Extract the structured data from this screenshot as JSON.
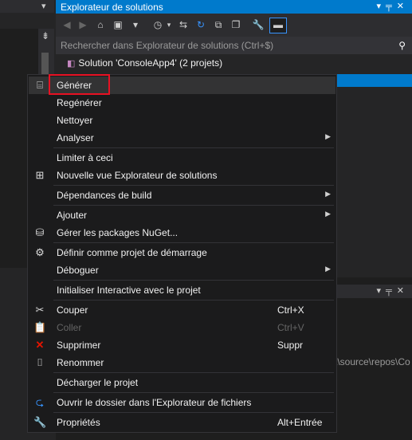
{
  "solution_explorer": {
    "title": "Explorateur de solutions",
    "search_placeholder": "Rechercher dans Explorateur de solutions (Ctrl+$)",
    "solution_node": "Solution 'ConsoleApp4' (2 projets)"
  },
  "lower_panel": {
    "path_fragment": "t\\source\\repos\\Co"
  },
  "menu": {
    "items": [
      {
        "label": "Générer",
        "shortcut": "",
        "submenu": false,
        "icon": "build-icon",
        "enabled": true
      },
      {
        "label": "Regénérer",
        "shortcut": "",
        "submenu": false,
        "icon": "",
        "enabled": true
      },
      {
        "label": "Nettoyer",
        "shortcut": "",
        "submenu": false,
        "icon": "",
        "enabled": true
      },
      {
        "label": "Analyser",
        "shortcut": "",
        "submenu": true,
        "icon": "",
        "enabled": true
      },
      {
        "label": "Limiter à ceci",
        "shortcut": "",
        "submenu": false,
        "icon": "",
        "enabled": true
      },
      {
        "label": "Nouvelle vue Explorateur de solutions",
        "shortcut": "",
        "submenu": false,
        "icon": "new-view-icon",
        "enabled": true
      },
      {
        "label": "Dépendances de build",
        "shortcut": "",
        "submenu": true,
        "icon": "",
        "enabled": true
      },
      {
        "label": "Ajouter",
        "shortcut": "",
        "submenu": true,
        "icon": "",
        "enabled": true
      },
      {
        "label": "Gérer les packages NuGet...",
        "shortcut": "",
        "submenu": false,
        "icon": "nuget-icon",
        "enabled": true
      },
      {
        "label": "Définir comme projet de démarrage",
        "shortcut": "",
        "submenu": false,
        "icon": "gear-icon",
        "enabled": true
      },
      {
        "label": "Déboguer",
        "shortcut": "",
        "submenu": true,
        "icon": "",
        "enabled": true
      },
      {
        "label": "Initialiser Interactive avec le projet",
        "shortcut": "",
        "submenu": false,
        "icon": "",
        "enabled": true
      },
      {
        "label": "Couper",
        "shortcut": "Ctrl+X",
        "submenu": false,
        "icon": "cut-icon",
        "enabled": true
      },
      {
        "label": "Coller",
        "shortcut": "Ctrl+V",
        "submenu": false,
        "icon": "paste-icon",
        "enabled": false
      },
      {
        "label": "Supprimer",
        "shortcut": "Suppr",
        "submenu": false,
        "icon": "delete-icon",
        "enabled": true
      },
      {
        "label": "Renommer",
        "shortcut": "",
        "submenu": false,
        "icon": "rename-icon",
        "enabled": true
      },
      {
        "label": "Décharger le projet",
        "shortcut": "",
        "submenu": false,
        "icon": "",
        "enabled": true
      },
      {
        "label": "Ouvrir le dossier dans l'Explorateur de fichiers",
        "shortcut": "",
        "submenu": false,
        "icon": "open-folder-icon",
        "enabled": true
      },
      {
        "label": "Propriétés",
        "shortcut": "Alt+Entrée",
        "submenu": false,
        "icon": "wrench-icon",
        "enabled": true
      }
    ]
  },
  "colors": {
    "accent": "#007acc",
    "highlight_box": "#e81123",
    "delete_icon": "#e51400",
    "open_folder_icon": "#3794ff"
  }
}
